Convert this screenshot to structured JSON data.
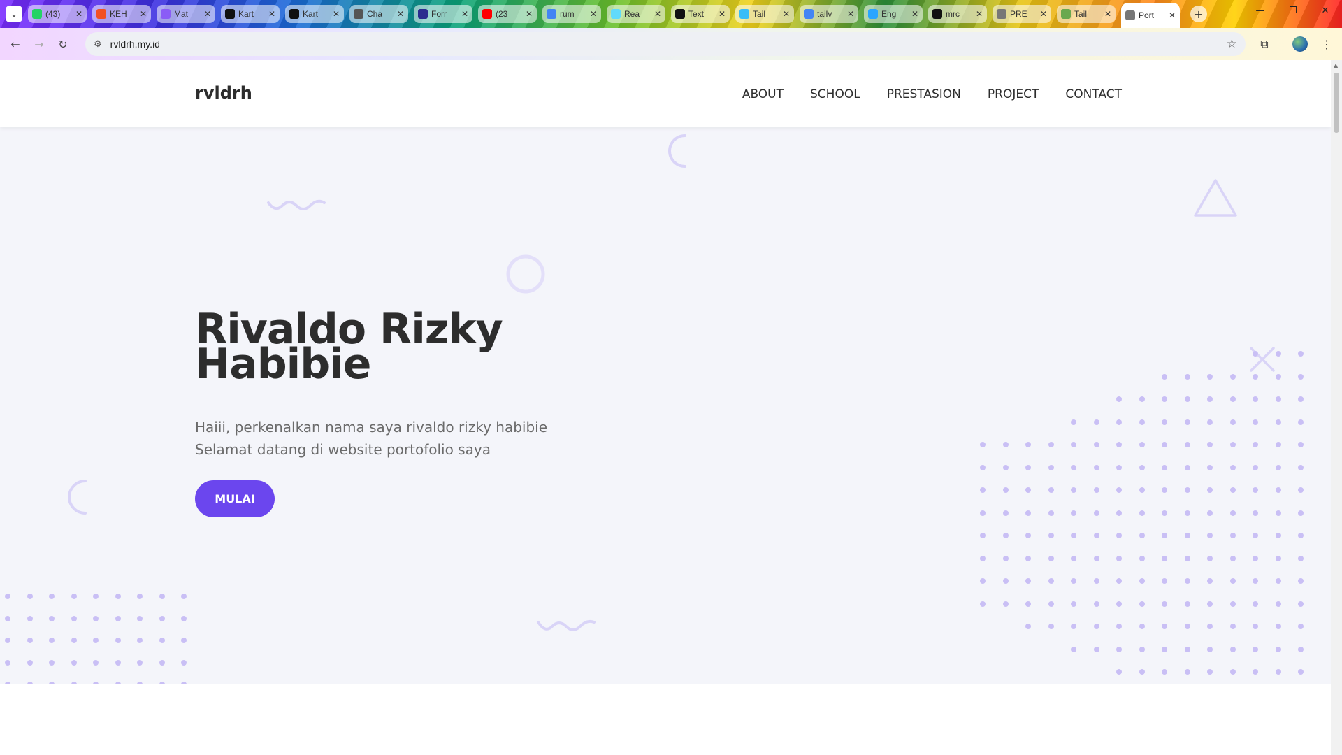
{
  "browser": {
    "tabs": [
      {
        "title": "(43)",
        "favicon_color": "#25d366"
      },
      {
        "title": "KEH",
        "favicon_color": "#f25022"
      },
      {
        "title": "Mat",
        "favicon_color": "#8a5cf6"
      },
      {
        "title": "Kart",
        "favicon_color": "#111111"
      },
      {
        "title": "Kart",
        "favicon_color": "#111111"
      },
      {
        "title": "Cha",
        "favicon_color": "#555555"
      },
      {
        "title": "Forr",
        "favicon_color": "#2b2b8f"
      },
      {
        "title": "(23",
        "favicon_color": "#ff0000"
      },
      {
        "title": "rum",
        "favicon_color": "#4285f4"
      },
      {
        "title": "Rea",
        "favicon_color": "#61dafb"
      },
      {
        "title": "Text",
        "favicon_color": "#111111"
      },
      {
        "title": "Tail",
        "favicon_color": "#38bdf8"
      },
      {
        "title": "tailv",
        "favicon_color": "#4285f4"
      },
      {
        "title": "Eng",
        "favicon_color": "#2aa5ff"
      },
      {
        "title": "mrc",
        "favicon_color": "#111111"
      },
      {
        "title": "PRE",
        "favicon_color": "#777777"
      },
      {
        "title": "Tail",
        "favicon_color": "#6aa84f"
      },
      {
        "title": "Port",
        "favicon_color": "#777777",
        "active": true
      }
    ],
    "address": "rvldrh.my.id"
  },
  "site": {
    "logo": "rvldrh",
    "nav": [
      "ABOUT",
      "SCHOOL",
      "PRESTASION",
      "PROJECT",
      "CONTACT"
    ],
    "hero": {
      "title_line1": "Rivaldo Rizky",
      "title_line2": "Habibie",
      "text_line1": "Haiii, perkenalkan nama saya rivaldo rizky habibie",
      "text_line2": "Selamat datang di website portofolio saya",
      "cta": "MULAI"
    }
  },
  "colors": {
    "accent": "#6b46ee",
    "hero_bg": "#f4f5fa",
    "deco": "#d9d4f7",
    "dots": "#c9bff5"
  }
}
